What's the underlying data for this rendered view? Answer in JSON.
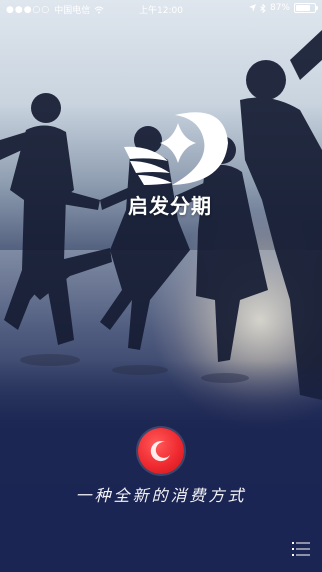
{
  "status_bar": {
    "carrier": "中国电信",
    "time": "上午12:00",
    "battery_text": "87%",
    "battery_level": 0.87,
    "icons": [
      "signal-dots-icon",
      "wifi-icon",
      "location-icon",
      "bluetooth-icon",
      "battery-icon"
    ]
  },
  "brand": {
    "name": "启发分期",
    "logo_icon": "crescent-sparkle-logo"
  },
  "main": {
    "action_icon": "record-icon",
    "tagline": "一种全新的消费方式"
  },
  "menu": {
    "icon": "list-menu-icon"
  },
  "colors": {
    "accent": "#ef2a30",
    "background_dark": "#1b2553",
    "text": "#ffffff"
  }
}
